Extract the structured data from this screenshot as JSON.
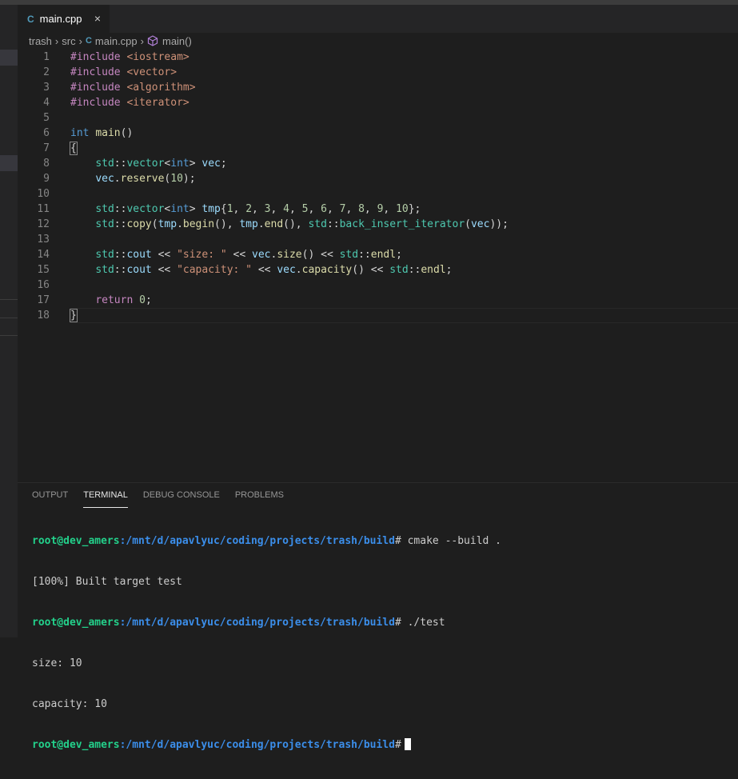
{
  "tab": {
    "icon": "C",
    "label": "main.cpp",
    "close": "×"
  },
  "breadcrumb": {
    "folder1": "trash",
    "folder2": "src",
    "file_icon": "C",
    "file": "main.cpp",
    "symbol": "main()"
  },
  "editor": {
    "lines": [
      [
        [
          "#include ",
          "#c586c0"
        ],
        [
          "<iostream>",
          "#ce9178"
        ]
      ],
      [
        [
          "#include ",
          "#c586c0"
        ],
        [
          "<vector>",
          "#ce9178"
        ]
      ],
      [
        [
          "#include ",
          "#c586c0"
        ],
        [
          "<algorithm>",
          "#ce9178"
        ]
      ],
      [
        [
          "#include ",
          "#c586c0"
        ],
        [
          "<iterator>",
          "#ce9178"
        ]
      ],
      [],
      [
        [
          "int",
          "#569cd6"
        ],
        [
          " ",
          "#d4d4d4"
        ],
        [
          "main",
          "#dcdcaa"
        ],
        [
          "()",
          "#d4d4d4"
        ]
      ],
      [
        [
          "{",
          "#d4d4d4"
        ]
      ],
      [
        [
          "    ",
          "#d4d4d4"
        ],
        [
          "std",
          "#4ec9b0"
        ],
        [
          "::",
          "#d4d4d4"
        ],
        [
          "vector",
          "#4ec9b0"
        ],
        [
          "<",
          "#d4d4d4"
        ],
        [
          "int",
          "#569cd6"
        ],
        [
          "> ",
          "#d4d4d4"
        ],
        [
          "vec",
          "#9cdcfe"
        ],
        [
          ";",
          "#d4d4d4"
        ]
      ],
      [
        [
          "    ",
          "#d4d4d4"
        ],
        [
          "vec",
          "#9cdcfe"
        ],
        [
          ".",
          "#d4d4d4"
        ],
        [
          "reserve",
          "#dcdcaa"
        ],
        [
          "(",
          "#d4d4d4"
        ],
        [
          "10",
          "#b5cea8"
        ],
        [
          ");",
          "#d4d4d4"
        ]
      ],
      [],
      [
        [
          "    ",
          "#d4d4d4"
        ],
        [
          "std",
          "#4ec9b0"
        ],
        [
          "::",
          "#d4d4d4"
        ],
        [
          "vector",
          "#4ec9b0"
        ],
        [
          "<",
          "#d4d4d4"
        ],
        [
          "int",
          "#569cd6"
        ],
        [
          "> ",
          "#d4d4d4"
        ],
        [
          "tmp",
          "#9cdcfe"
        ],
        [
          "{",
          "#d4d4d4"
        ],
        [
          "1",
          "#b5cea8"
        ],
        [
          ", ",
          "#d4d4d4"
        ],
        [
          "2",
          "#b5cea8"
        ],
        [
          ", ",
          "#d4d4d4"
        ],
        [
          "3",
          "#b5cea8"
        ],
        [
          ", ",
          "#d4d4d4"
        ],
        [
          "4",
          "#b5cea8"
        ],
        [
          ", ",
          "#d4d4d4"
        ],
        [
          "5",
          "#b5cea8"
        ],
        [
          ", ",
          "#d4d4d4"
        ],
        [
          "6",
          "#b5cea8"
        ],
        [
          ", ",
          "#d4d4d4"
        ],
        [
          "7",
          "#b5cea8"
        ],
        [
          ", ",
          "#d4d4d4"
        ],
        [
          "8",
          "#b5cea8"
        ],
        [
          ", ",
          "#d4d4d4"
        ],
        [
          "9",
          "#b5cea8"
        ],
        [
          ", ",
          "#d4d4d4"
        ],
        [
          "10",
          "#b5cea8"
        ],
        [
          "};",
          "#d4d4d4"
        ]
      ],
      [
        [
          "    ",
          "#d4d4d4"
        ],
        [
          "std",
          "#4ec9b0"
        ],
        [
          "::",
          "#d4d4d4"
        ],
        [
          "copy",
          "#dcdcaa"
        ],
        [
          "(",
          "#d4d4d4"
        ],
        [
          "tmp",
          "#9cdcfe"
        ],
        [
          ".",
          "#d4d4d4"
        ],
        [
          "begin",
          "#dcdcaa"
        ],
        [
          "(), ",
          "#d4d4d4"
        ],
        [
          "tmp",
          "#9cdcfe"
        ],
        [
          ".",
          "#d4d4d4"
        ],
        [
          "end",
          "#dcdcaa"
        ],
        [
          "(), ",
          "#d4d4d4"
        ],
        [
          "std",
          "#4ec9b0"
        ],
        [
          "::",
          "#d4d4d4"
        ],
        [
          "back_insert_iterator",
          "#4ec9b0"
        ],
        [
          "(",
          "#d4d4d4"
        ],
        [
          "vec",
          "#9cdcfe"
        ],
        [
          "));",
          "#d4d4d4"
        ]
      ],
      [],
      [
        [
          "    ",
          "#d4d4d4"
        ],
        [
          "std",
          "#4ec9b0"
        ],
        [
          "::",
          "#d4d4d4"
        ],
        [
          "cout",
          "#9cdcfe"
        ],
        [
          " << ",
          "#d4d4d4"
        ],
        [
          "\"size: \"",
          "#ce9178"
        ],
        [
          " << ",
          "#d4d4d4"
        ],
        [
          "vec",
          "#9cdcfe"
        ],
        [
          ".",
          "#d4d4d4"
        ],
        [
          "size",
          "#dcdcaa"
        ],
        [
          "() << ",
          "#d4d4d4"
        ],
        [
          "std",
          "#4ec9b0"
        ],
        [
          "::",
          "#d4d4d4"
        ],
        [
          "endl",
          "#dcdcaa"
        ],
        [
          ";",
          "#d4d4d4"
        ]
      ],
      [
        [
          "    ",
          "#d4d4d4"
        ],
        [
          "std",
          "#4ec9b0"
        ],
        [
          "::",
          "#d4d4d4"
        ],
        [
          "cout",
          "#9cdcfe"
        ],
        [
          " << ",
          "#d4d4d4"
        ],
        [
          "\"capacity: \"",
          "#ce9178"
        ],
        [
          " << ",
          "#d4d4d4"
        ],
        [
          "vec",
          "#9cdcfe"
        ],
        [
          ".",
          "#d4d4d4"
        ],
        [
          "capacity",
          "#dcdcaa"
        ],
        [
          "() << ",
          "#d4d4d4"
        ],
        [
          "std",
          "#4ec9b0"
        ],
        [
          "::",
          "#d4d4d4"
        ],
        [
          "endl",
          "#dcdcaa"
        ],
        [
          ";",
          "#d4d4d4"
        ]
      ],
      [],
      [
        [
          "    ",
          "#d4d4d4"
        ],
        [
          "return",
          "#c586c0"
        ],
        [
          " ",
          "#d4d4d4"
        ],
        [
          "0",
          "#b5cea8"
        ],
        [
          ";",
          "#d4d4d4"
        ]
      ],
      [
        [
          "}",
          "#d4d4d4"
        ]
      ]
    ]
  },
  "panel": {
    "tabs": [
      "OUTPUT",
      "TERMINAL",
      "DEBUG CONSOLE",
      "PROBLEMS"
    ],
    "active_tab": "TERMINAL",
    "terminal": {
      "user": "root@dev_amers",
      "path": ":/mnt/d/apavlyuc/coding/projects/trash/build",
      "cmd1": "# cmake --build .",
      "out1": "[100%] Built target test",
      "cmd2": "# ./test",
      "out2": "size: 10",
      "out3": "capacity: 10",
      "cmd3": "#"
    }
  }
}
